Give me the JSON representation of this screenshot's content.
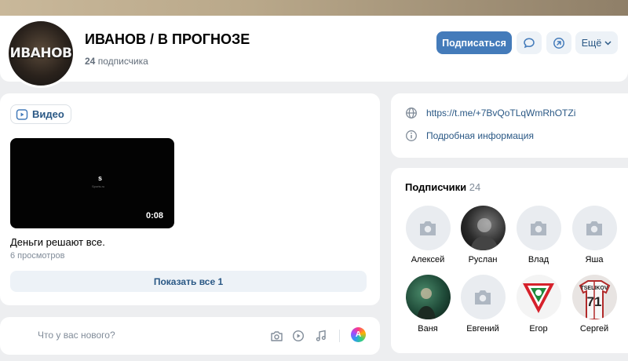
{
  "header": {
    "avatar_text": "ИВАНОВ",
    "title": "ИВАНОВ / В ПРОГНОЗЕ",
    "subscribers_count": "24",
    "subscribers_label": "подписчика",
    "subscribe_label": "Подписаться",
    "more_label": "Ещё"
  },
  "video_block": {
    "tab_label": "Видео",
    "video": {
      "title": "Деньги решают все.",
      "views": "6 просмотров",
      "duration": "0:08",
      "logo_text": "s",
      "logo_caption": "Sports.ru"
    },
    "show_all_label": "Показать все 1"
  },
  "post_box": {
    "placeholder": "Что у вас нового?"
  },
  "info": {
    "link": "https://t.me/+7BvQoTLqWmRhOTZi",
    "details_label": "Подробная информация"
  },
  "subscribers": {
    "title": "Подписчики",
    "count": "24",
    "items": [
      {
        "name": "Алексей",
        "photo": "empty"
      },
      {
        "name": "Руслан",
        "photo": "dark"
      },
      {
        "name": "Влад",
        "photo": "empty"
      },
      {
        "name": "Яша",
        "photo": "empty"
      },
      {
        "name": "Ваня",
        "photo": "green"
      },
      {
        "name": "Евгений",
        "photo": "empty"
      },
      {
        "name": "Егор",
        "photo": "logo"
      },
      {
        "name": "Сергей",
        "photo": "jersey"
      }
    ],
    "jersey_name": "TSELIKOV",
    "jersey_number": "71"
  },
  "colors": {
    "accent": "#447bba",
    "link": "#2a5885",
    "background": "#edeef0",
    "secondary_text": "#818c99"
  }
}
